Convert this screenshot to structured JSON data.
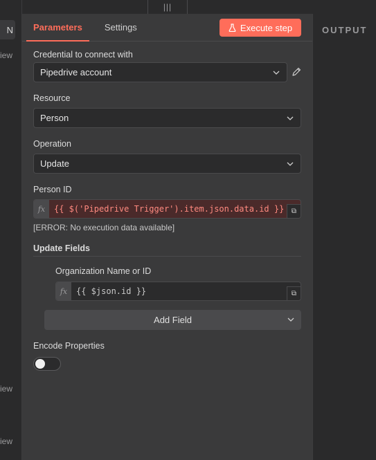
{
  "left_panel": {
    "button_label": "N",
    "view_labels": [
      "view",
      "view",
      "view"
    ]
  },
  "drag_handle": {
    "glyph": "|||"
  },
  "tabs": [
    {
      "label": "Parameters",
      "active": true
    },
    {
      "label": "Settings",
      "active": false
    }
  ],
  "execute_button": {
    "label": "Execute step",
    "icon": "flask-icon",
    "color": "#ff6d5a"
  },
  "credential": {
    "label": "Credential to connect with",
    "value": "Pipedrive account"
  },
  "resource": {
    "label": "Resource",
    "value": "Person"
  },
  "operation": {
    "label": "Operation",
    "value": "Update"
  },
  "person_id": {
    "label": "Person ID",
    "fx": "fx",
    "expression": "{{ $('Pipedrive Trigger').item.json.data.id }}",
    "error": "[ERROR: No execution data available]"
  },
  "update_fields": {
    "title": "Update Fields",
    "org_label": "Organization Name or ID",
    "fx": "fx",
    "org_expression": "{{ $json.id }}",
    "add_field_label": "Add Field"
  },
  "encode": {
    "label": "Encode Properties",
    "enabled": false
  },
  "output_panel": {
    "title": "OUTPUT"
  },
  "colors": {
    "accent": "#ff6d5a",
    "panel": "#3a3a3b",
    "background": "#2a2a2b"
  }
}
